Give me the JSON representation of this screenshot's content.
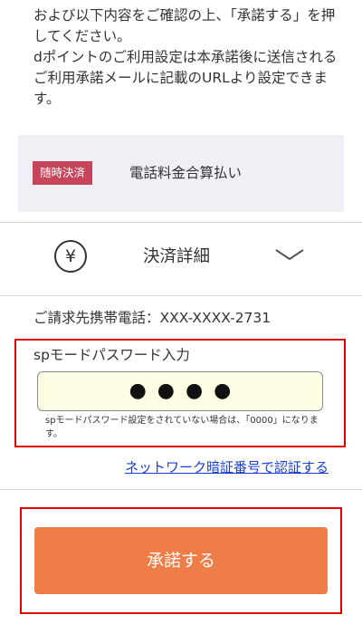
{
  "intro": {
    "line1": "および以下内容をご確認の上、「承諾する」を押してください。",
    "line2": "dポイントのご利用設定は本承諾後に送信されるご利用承諾メールに記載のURLより設定できます。"
  },
  "payment": {
    "badge": "随時決済",
    "method": "電話料金合算払い"
  },
  "details": {
    "icon": "yen-icon",
    "title": "決済詳細"
  },
  "billing": {
    "phone_label": "ご請求先携帯電話：XXX-XXXX-2731"
  },
  "password": {
    "label": "spモードパスワード入力",
    "value": "●●●●",
    "note": "spモードパスワード設定をされていない場合は、「0000」になります。"
  },
  "auth_link": "ネットワーク暗証番号で認証する",
  "accept_button": "承諾する",
  "colors": {
    "accent_button": "#ef7d48",
    "badge": "#c7455b",
    "link": "#1a3fd6",
    "highlight_frame": "#e00000"
  }
}
